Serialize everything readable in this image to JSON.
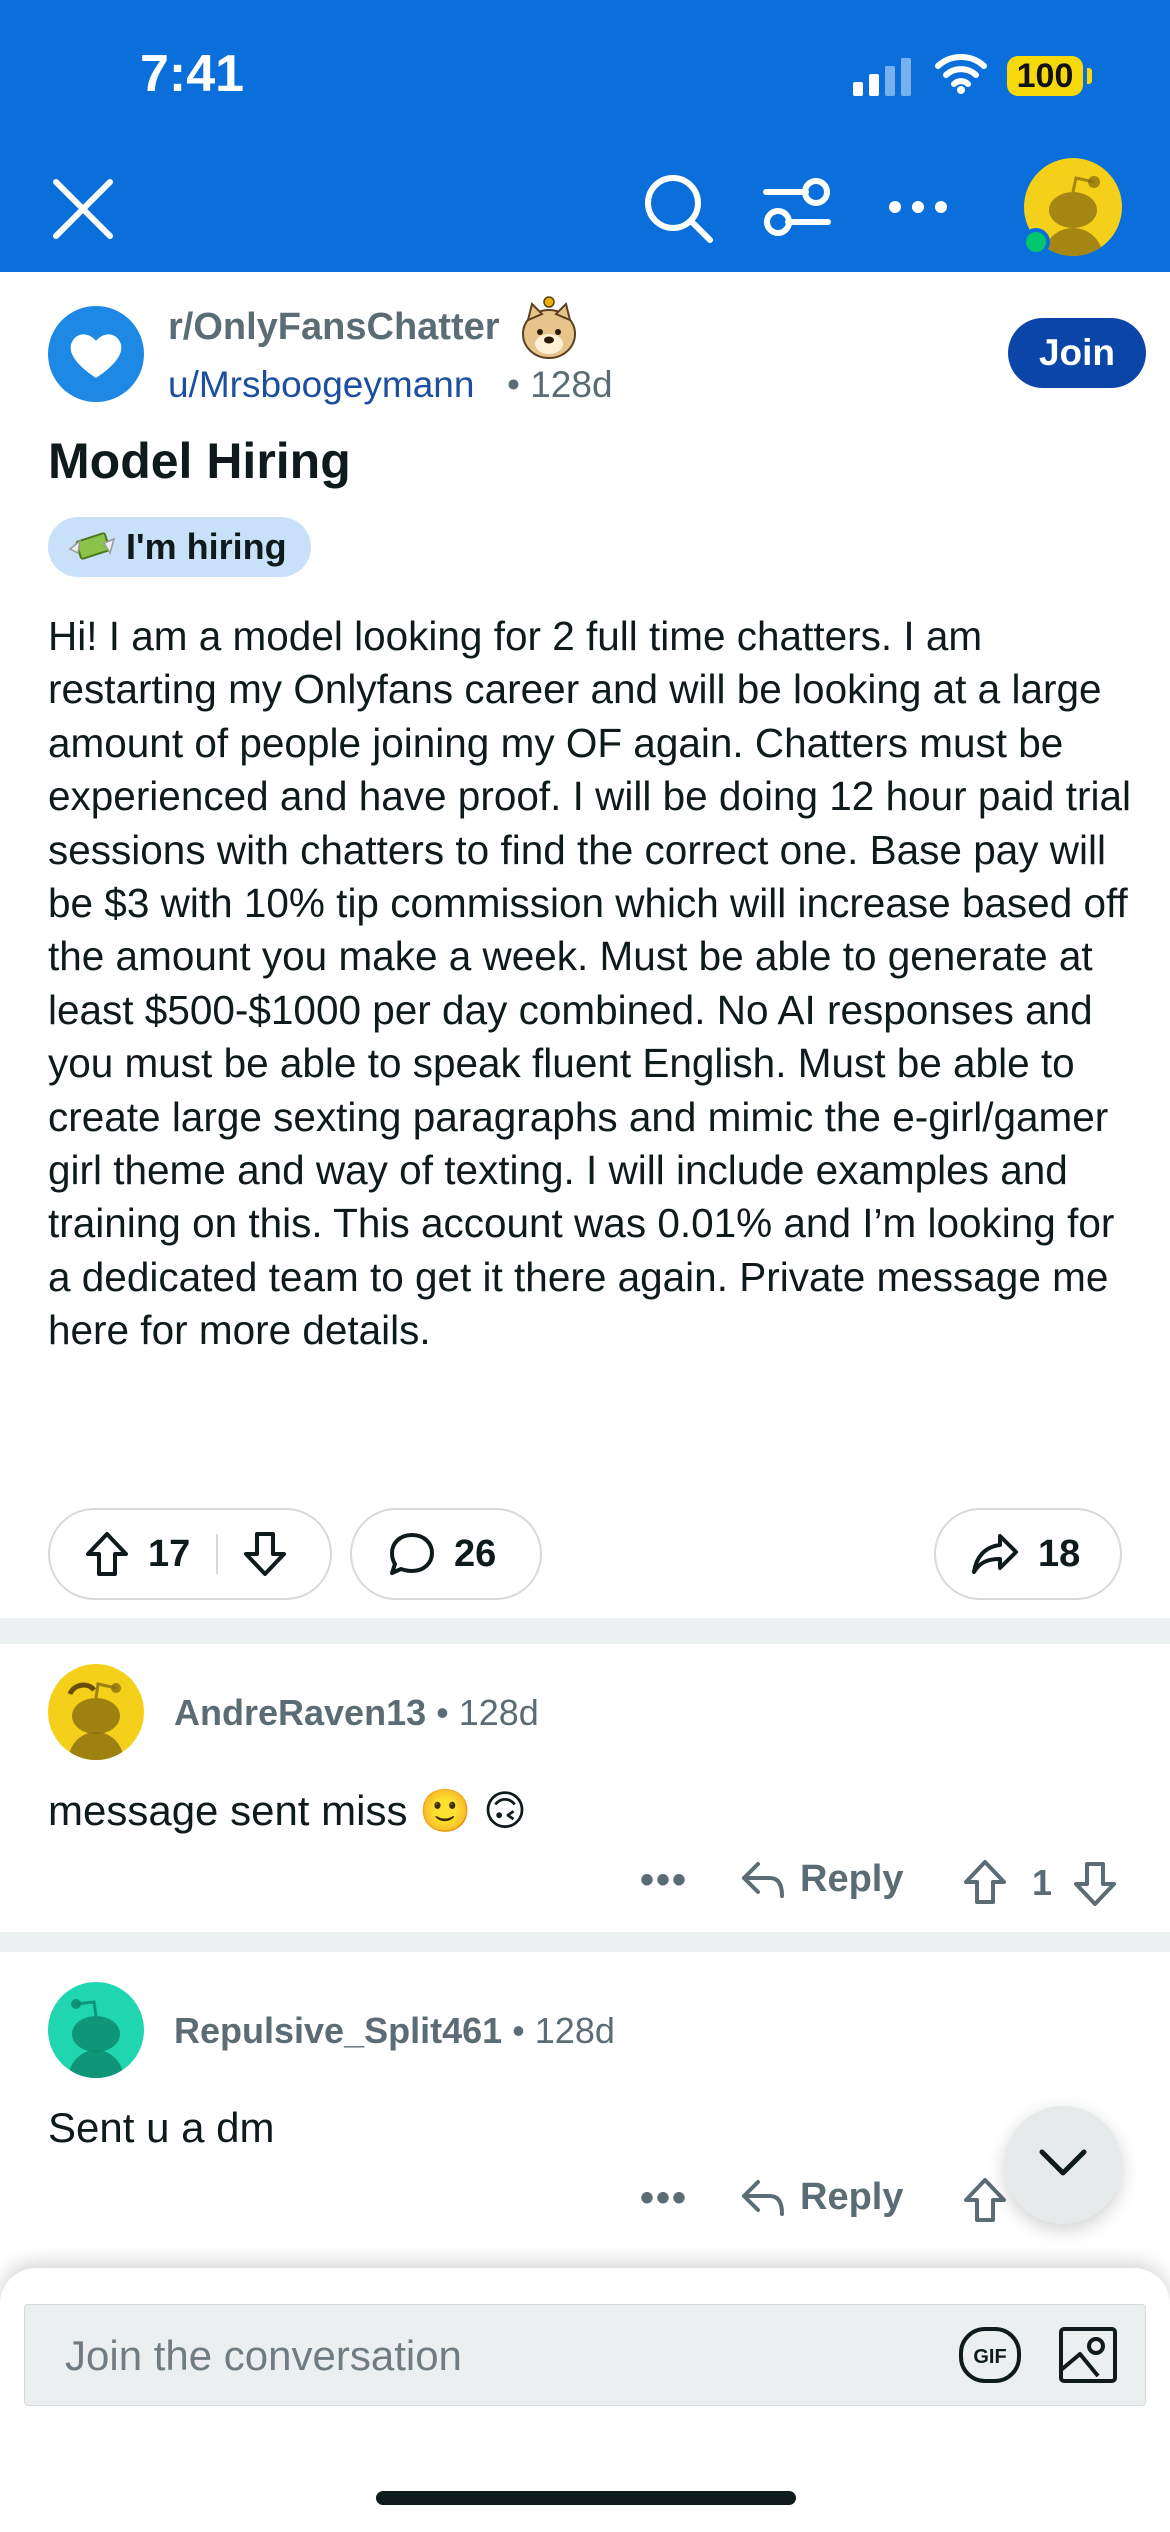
{
  "status_bar": {
    "time": "7:41",
    "battery": "100"
  },
  "nav": {
    "close_icon": "close-icon",
    "search_icon": "search-icon",
    "filter_icon": "sort-filter-icon",
    "more_icon": "more-dots-icon",
    "avatar": "snoo-avatar"
  },
  "post": {
    "subreddit": "r/OnlyFansChatter",
    "author": "u/Mrsboogeymann",
    "age": "128d",
    "join_label": "Join",
    "title": "Model Hiring",
    "flair": "I'm hiring",
    "body": "Hi! I am a model looking for 2 full time chatters. I am restarting my Onlyfans career and will be looking at a large amount of people joining my OF again. Chatters must be experienced and have proof. I will be doing 12 hour paid trial sessions with chatters to find the correct one. Base pay will be $3 with 10% tip commission which will increase based off the amount you make a week. Must be able to generate at least $500-$1000 per day combined. No AI responses and you must be able to speak fluent English. Must be able to create large sexting paragraphs and mimic the e-girl/gamer girl theme and way of texting. I will include examples and training on this. This account was 0.01% and I’m looking for a dedicated team to get it there again. Private message me here for more details.",
    "upvotes": "17",
    "comments": "26",
    "shares": "18"
  },
  "comments": [
    {
      "user": "AndreRaven13",
      "age": "128d",
      "text": "message sent miss 🙂 🙃",
      "reply_label": "Reply",
      "score": "1",
      "avatar_color": "#f5d01a"
    },
    {
      "user": "Repulsive_Split461",
      "age": "128d",
      "text": "Sent u a dm",
      "reply_label": "Reply",
      "score": "",
      "avatar_color": "#1fd6b0"
    }
  ],
  "composer": {
    "placeholder": "Join the conversation",
    "gif_label": "GIF"
  },
  "colors": {
    "brand_blue": "#0a6fdb",
    "join_blue": "#0c45a8",
    "flair_bg": "#c8e0f8"
  }
}
